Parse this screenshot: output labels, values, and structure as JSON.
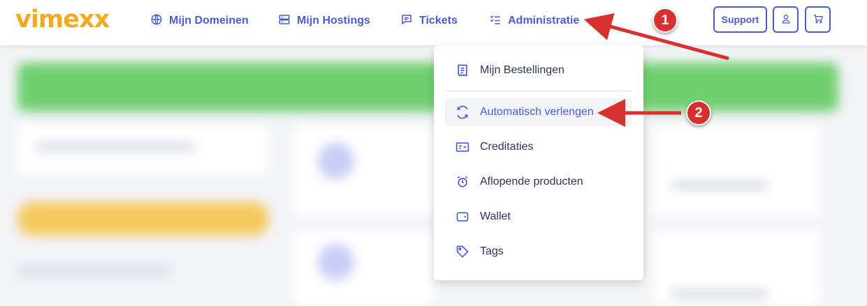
{
  "header": {
    "logo": "vimexx",
    "nav": [
      {
        "label": "Mijn Domeinen",
        "icon": "globe-icon"
      },
      {
        "label": "Mijn Hostings",
        "icon": "server-icon"
      },
      {
        "label": "Tickets",
        "icon": "chat-icon"
      },
      {
        "label": "Administratie",
        "icon": "checklist-icon"
      }
    ],
    "support_label": "Support"
  },
  "dropdown": {
    "items": [
      {
        "label": "Mijn Bestellingen",
        "icon": "receipt-icon"
      },
      {
        "label": "Automatisch verlengen",
        "icon": "refresh-icon",
        "active": true
      },
      {
        "label": "Creditaties",
        "icon": "credit-card-icon"
      },
      {
        "label": "Aflopende producten",
        "icon": "alarm-clock-icon"
      },
      {
        "label": "Wallet",
        "icon": "wallet-icon"
      },
      {
        "label": "Tags",
        "icon": "tag-icon"
      }
    ]
  },
  "annotations": {
    "badge1": "1",
    "badge2": "2"
  },
  "colors": {
    "accent": "#4a5bd4",
    "logo": "#f7a823",
    "annotation": "#d82f2f"
  }
}
